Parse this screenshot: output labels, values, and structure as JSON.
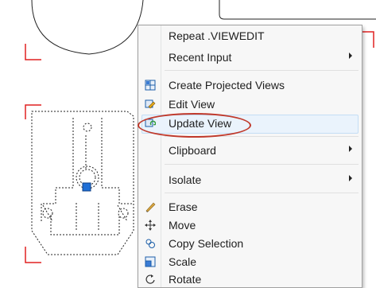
{
  "context_menu": {
    "items": [
      {
        "label": "Repeat .VIEWEDIT",
        "icon": "",
        "submenu": false
      },
      {
        "label": "Recent Input",
        "icon": "",
        "submenu": true
      },
      {
        "label": "Create Projected Views",
        "icon": "projected-views-icon",
        "submenu": false
      },
      {
        "label": "Edit View",
        "icon": "edit-view-icon",
        "submenu": false
      },
      {
        "label": "Update View",
        "icon": "update-view-icon",
        "submenu": false,
        "highlighted": true
      },
      {
        "label": "Clipboard",
        "icon": "",
        "submenu": true
      },
      {
        "label": "Isolate",
        "icon": "",
        "submenu": true
      },
      {
        "label": "Erase",
        "icon": "erase-icon",
        "submenu": false
      },
      {
        "label": "Move",
        "icon": "move-icon",
        "submenu": false
      },
      {
        "label": "Copy Selection",
        "icon": "copy-selection-icon",
        "submenu": false
      },
      {
        "label": "Scale",
        "icon": "scale-icon",
        "submenu": false
      },
      {
        "label": "Rotate",
        "icon": "rotate-icon",
        "submenu": false
      }
    ]
  },
  "colors": {
    "menu_bg": "#f7f7f7",
    "annotation_oval": "#c0392b",
    "viewport_corner": "#e02020",
    "grip": "#1f6fd6"
  }
}
